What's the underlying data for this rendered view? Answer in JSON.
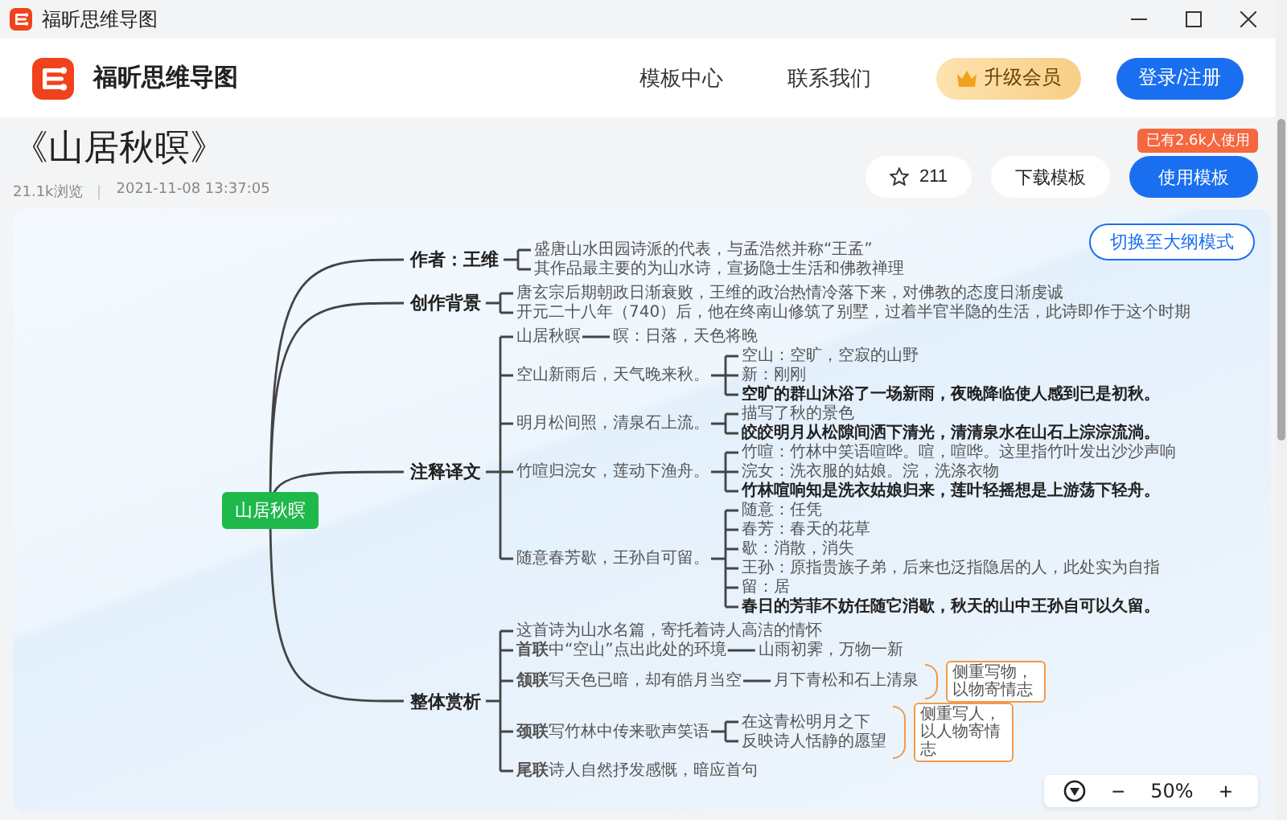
{
  "window": {
    "title": "福昕思维导图"
  },
  "header": {
    "brand": "福昕思维导图",
    "nav": [
      {
        "label": "模板中心"
      },
      {
        "label": "联系我们"
      }
    ],
    "vip_button": "升级会员",
    "login_button": "登录/注册"
  },
  "template": {
    "title": "《山居秋暝》",
    "views": "21.1k浏览",
    "date": "2021-11-08 13:37:05",
    "usage_badge": "已有2.6k人使用",
    "favorites": "211",
    "download_button": "下载模板",
    "use_button": "使用模板"
  },
  "canvas": {
    "outline_button": "切换至大纲模式",
    "zoom": "50%",
    "zoom_out": "−",
    "zoom_in": "+"
  },
  "mind_map": {
    "root": "山居秋暝",
    "branches": [
      {
        "text": "作者：王维",
        "kind": "branch",
        "children": [
          {
            "text": "盛唐山水田园诗派的代表，与孟浩然并称“王孟”",
            "kind": "text"
          },
          {
            "text": "其作品最主要的为山水诗，宣扬隐士生活和佛教禅理",
            "kind": "text"
          }
        ]
      },
      {
        "text": "创作背景",
        "kind": "branch",
        "children": [
          {
            "text": "唐玄宗后期朝政日渐衰败，王维的政治热情冷落下来，对佛教的态度日渐虔诚",
            "kind": "text"
          },
          {
            "text": "开元二十八年（740）后，他在终南山修筑了别墅，过着半官半隐的生活，此诗即作于这个时期",
            "kind": "text"
          }
        ]
      },
      {
        "text": "注释译文",
        "kind": "branch",
        "children": [
          {
            "text": "山居秋暝",
            "kind": "text",
            "children": [
              {
                "text": "暝：日落，天色将晚",
                "kind": "text"
              }
            ]
          },
          {
            "text": "空山新雨后，天气晚来秋。",
            "kind": "text",
            "children": [
              {
                "text": "空山：空旷，空寂的山野",
                "kind": "text"
              },
              {
                "text": "新：刚刚",
                "kind": "text"
              },
              {
                "text": "空旷的群山沐浴了一场新雨，夜晚降临使人感到已是初秋。",
                "kind": "bold"
              }
            ]
          },
          {
            "text": "明月松间照，清泉石上流。",
            "kind": "text",
            "children": [
              {
                "text": "描写了秋的景色",
                "kind": "text"
              },
              {
                "text": "皎皎明月从松隙间洒下清光，清清泉水在山石上淙淙流淌。",
                "kind": "bold"
              }
            ]
          },
          {
            "text": "竹喧归浣女，莲动下渔舟。",
            "kind": "text",
            "children": [
              {
                "text": "竹喧：竹林中笑语喧哗。喧，喧哗。这里指竹叶发出沙沙声响",
                "kind": "text"
              },
              {
                "text": "浣女：洗衣服的姑娘。浣，洗涤衣物",
                "kind": "text"
              },
              {
                "text": "竹林喧响知是洗衣姑娘归来，莲叶轻摇想是上游荡下轻舟。",
                "kind": "bold"
              }
            ]
          },
          {
            "text": "随意春芳歇，王孙自可留。",
            "kind": "text",
            "children": [
              {
                "text": "随意：任凭",
                "kind": "text"
              },
              {
                "text": "春芳：春天的花草",
                "kind": "text"
              },
              {
                "text": "歇：消散，消失",
                "kind": "text"
              },
              {
                "text": "王孙：原指贵族子弟，后来也泛指隐居的人，此处实为自指",
                "kind": "text"
              },
              {
                "text": "留：居",
                "kind": "text"
              },
              {
                "text": "春日的芳菲不妨任随它消歇，秋天的山中王孙自可以久留。",
                "kind": "bold"
              }
            ]
          }
        ]
      },
      {
        "text": "整体赏析",
        "kind": "branch",
        "children": [
          {
            "text": "这首诗为山水名篇，寄托着诗人高洁的情怀",
            "kind": "text"
          },
          {
            "text": "**首联**中“空山”点出此处的环境",
            "kind": "text",
            "children": [
              {
                "text": "山雨初霁，万物一新",
                "kind": "text"
              }
            ]
          },
          {
            "text": "**颔联**写天色已暗，却有皓月当空",
            "kind": "text",
            "children": [
              {
                "text": "月下青松和石上清泉",
                "kind": "text"
              }
            ],
            "summary": "侧重写物，以物寄情志"
          },
          {
            "text": "**颈联**写竹林中传来歌声笑语",
            "kind": "text",
            "children": [
              {
                "text": "在这青松明月之下",
                "kind": "text"
              },
              {
                "text": "反映诗人恬静的愿望",
                "kind": "text"
              }
            ],
            "summary": "侧重写人，以人物寄情志"
          },
          {
            "text": "**尾联**诗人自然抒发感慨，暗应首句",
            "kind": "text"
          }
        ]
      }
    ]
  }
}
